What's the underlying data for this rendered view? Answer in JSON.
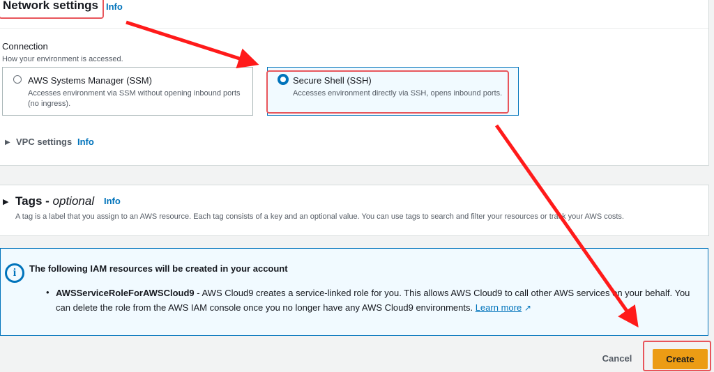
{
  "network": {
    "title": "Network settings",
    "info": "Info",
    "connection_label": "Connection",
    "connection_desc": "How your environment is accessed.",
    "options": [
      {
        "title": "AWS Systems Manager (SSM)",
        "desc": "Accesses environment via SSM without opening inbound ports (no ingress).",
        "selected": false
      },
      {
        "title": "Secure Shell (SSH)",
        "desc": "Accesses environment directly via SSH, opens inbound ports.",
        "selected": true
      }
    ],
    "vpc_label": "VPC settings",
    "vpc_info": "Info"
  },
  "tags": {
    "title": "Tags -",
    "optional": "optional",
    "info": "Info",
    "desc": "A tag is a label that you assign to an AWS resource. Each tag consists of a key and an optional value. You can use tags to search and filter your resources or track your AWS costs."
  },
  "iam": {
    "title": "The following IAM resources will be created in your account",
    "role": "AWSServiceRoleForAWSCloud9",
    "text": " - AWS Cloud9 creates a service-linked role for you. This allows AWS Cloud9 to call other AWS services on your behalf. You can delete the role from the AWS IAM console once you no longer have any AWS Cloud9 environments. ",
    "learn_more": "Learn more"
  },
  "footer": {
    "cancel": "Cancel",
    "create": "Create"
  },
  "colors": {
    "accent": "#0073bb",
    "primary_button": "#ec9c14",
    "annotation": "#ff1a1a"
  },
  "icons": [
    "info-circle-icon",
    "external-link-icon",
    "caret-right-icon",
    "radio-icon"
  ]
}
